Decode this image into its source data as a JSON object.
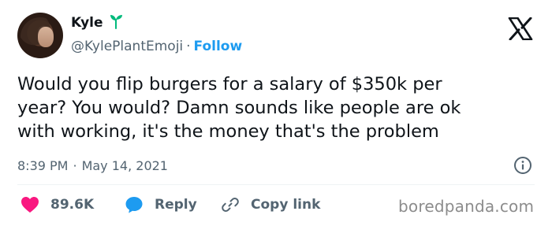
{
  "author": {
    "name": "Kyle",
    "handle": "@KylePlantEmoji",
    "separator": "·",
    "follow_label": "Follow",
    "name_emoji": "seedling-icon",
    "avatar": "avatar"
  },
  "platform_logo": "x-logo-icon",
  "tweet": {
    "text": "Would you flip burgers for a salary of $350k per\nyear? You would? Damn sounds like people are ok\nwith working, it's the money that's the problem"
  },
  "meta": {
    "time": "8:39 PM",
    "separator": "·",
    "date": "May 14, 2021",
    "info_icon": "info-icon"
  },
  "actions": {
    "likes": {
      "icon": "heart-icon",
      "count": "89.6K"
    },
    "reply": {
      "icon": "reply-bubble-icon",
      "label": "Reply"
    },
    "copy_link": {
      "icon": "link-icon",
      "label": "Copy link"
    }
  },
  "watermark": "boredpanda.com",
  "colors": {
    "text": "#0f1419",
    "secondary": "#536471",
    "accent": "#1d9bf0",
    "like": "#f91880",
    "divider": "#eff3f4",
    "sprout": "#00ba7c",
    "watermark": "#8c8c8c"
  }
}
